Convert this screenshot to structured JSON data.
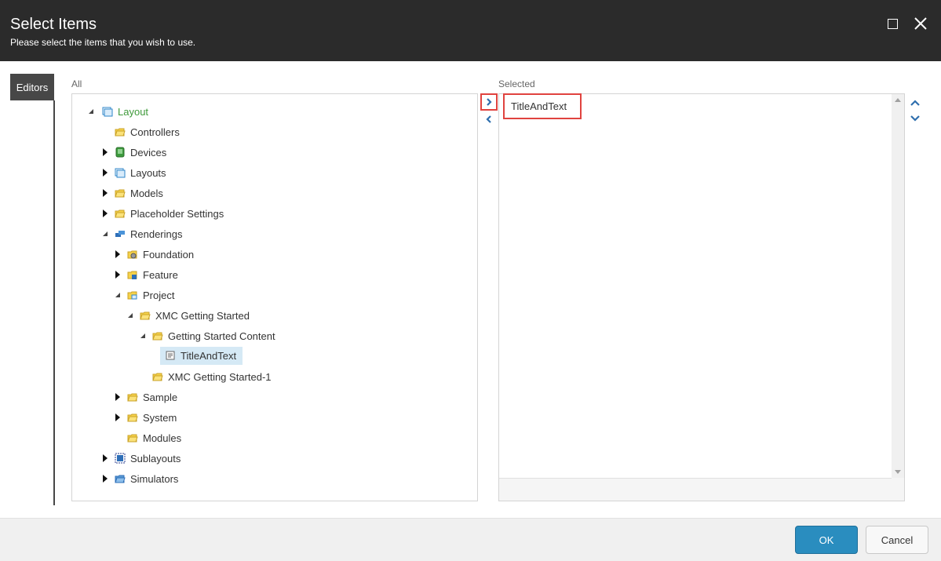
{
  "dialog": {
    "title": "Select Items",
    "subtitle": "Please select the items that you wish to use."
  },
  "sidebar": {
    "tab_label": "Editors"
  },
  "all_label": "All",
  "selected_label": "Selected",
  "tree": {
    "root": "Layout",
    "controllers": "Controllers",
    "devices": "Devices",
    "layouts": "Layouts",
    "models": "Models",
    "placeholder_settings": "Placeholder Settings",
    "renderings": "Renderings",
    "foundation": "Foundation",
    "feature": "Feature",
    "project": "Project",
    "xmc_getting_started": "XMC Getting Started",
    "getting_started_content": "Getting Started Content",
    "title_and_text": "TitleAndText",
    "xmc_getting_started_1": "XMC Getting Started-1",
    "sample": "Sample",
    "system": "System",
    "modules": "Modules",
    "sublayouts": "Sublayouts",
    "simulators": "Simulators"
  },
  "selected_items": [
    "TitleAndText"
  ],
  "footer": {
    "ok_label": "OK",
    "cancel_label": "Cancel"
  },
  "colors": {
    "header": "#2b2b2b",
    "accent": "#2a8dbf",
    "highlight": "#e0433f",
    "root": "#3f9a3b"
  }
}
